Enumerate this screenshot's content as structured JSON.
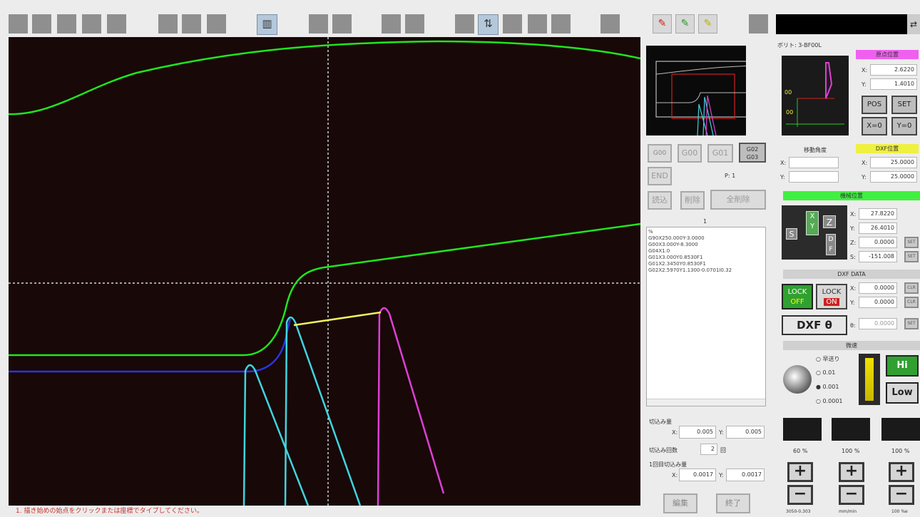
{
  "toolbar": {
    "highlighted_icons": [
      "ruler-icon",
      "compare-icon"
    ],
    "brush_icons": [
      "red-brush-icon",
      "green-brush-icon",
      "yellow-brush-icon"
    ],
    "exit_glyph": "⇄"
  },
  "canvas": {
    "background": "#180808",
    "colors": {
      "green": "#1ee61e",
      "blue": "#2a35e0",
      "cyan": "#3fd5df",
      "magenta": "#df3fd5",
      "yellow": "#f0f060",
      "crosshair": "#ffffff"
    }
  },
  "status_bar": {
    "message": "1. 描き始めの始点をクリックまたは座標でタイプしてください。"
  },
  "mid_panel": {
    "gcode_buttons": [
      "G00",
      "G00",
      "G01",
      "G02 G03"
    ],
    "end_label": "END",
    "p_label": "P: 1",
    "edit_buttons": [
      "読込",
      "削除",
      "全削除"
    ],
    "list_header": "1",
    "nc_lines": [
      "%",
      "G90X250.000Y-3.0000",
      "G00X3.000Y-8.3000",
      "G04X1.0",
      "G01X3.000Y0.8530F1",
      "G01X2.3450Y0.8530F1",
      "G02X2.5970Y1.1300-0.0701I0.32"
    ],
    "infeed_label": "切込み量",
    "infeed_x_label": "X:",
    "infeed_x": "0.005",
    "infeed_y_label": "Y:",
    "infeed_y": "0.005",
    "count_label": "切込み回数",
    "count_value": "2",
    "count_unit": "回",
    "first_label": "1回目切込み量",
    "first_x_label": "X:",
    "first_x": "0.0017",
    "first_y_label": "Y:",
    "first_y": "0.0017",
    "edit_button": "編集",
    "finish_button": "終了"
  },
  "right_panel": {
    "tool_label": "ボリト: 3-BF00L",
    "origin": {
      "title": "原点位置",
      "x_label": "X:",
      "x": "2.6220",
      "y_label": "Y:",
      "y": "1.4010",
      "color": "#f060f0"
    },
    "pos_buttons": [
      "POS",
      "SET",
      "X=0",
      "Y=0"
    ],
    "move": {
      "title": "移動角度",
      "x_label": "X:",
      "x": "",
      "y_label": "Y:",
      "y": ""
    },
    "dxf_pos": {
      "title": "DXF位置",
      "x_label": "X:",
      "x": "25.0000",
      "y_label": "Y:",
      "y": "25.0000",
      "color": "#f0f040"
    },
    "machine": {
      "title": "機械位置",
      "color": "#40f040",
      "x_label": "X:",
      "x": "27.8220",
      "y_label": "Y:",
      "y": "26.4010",
      "z_label": "Z:",
      "z": "0.0000",
      "s_label": "S:",
      "s": "-151.008",
      "set": "SET"
    },
    "dxf_data": {
      "title": "DXF DATA",
      "x_label": "X:",
      "x": "0.0000",
      "y_label": "Y:",
      "y": "0.0000",
      "t_label": "θ:",
      "t": "0.0000",
      "clr": "CLR",
      "set": "SET"
    },
    "lock_off": [
      "LOCK",
      "OFF"
    ],
    "lock_on": [
      "LOCK",
      "ON"
    ],
    "dxf_theta": "DXF θ",
    "step": {
      "title": "微速",
      "options": [
        "早送り",
        "0.01",
        "0.001",
        "0.0001"
      ],
      "selected": 2
    },
    "hi": "Hi",
    "low": "Low",
    "overrides": [
      {
        "icon": "spindle-cp-icon",
        "value": "60",
        "unit": "%",
        "caption": "3050-0.303"
      },
      {
        "icon": "feed-f-icon",
        "value": "100",
        "unit": "%",
        "caption": "mm/min"
      },
      {
        "icon": "rapid-n-icon",
        "value": "100",
        "unit": "%",
        "caption": "100 %e"
      }
    ],
    "plus": "+",
    "minus": "−"
  }
}
